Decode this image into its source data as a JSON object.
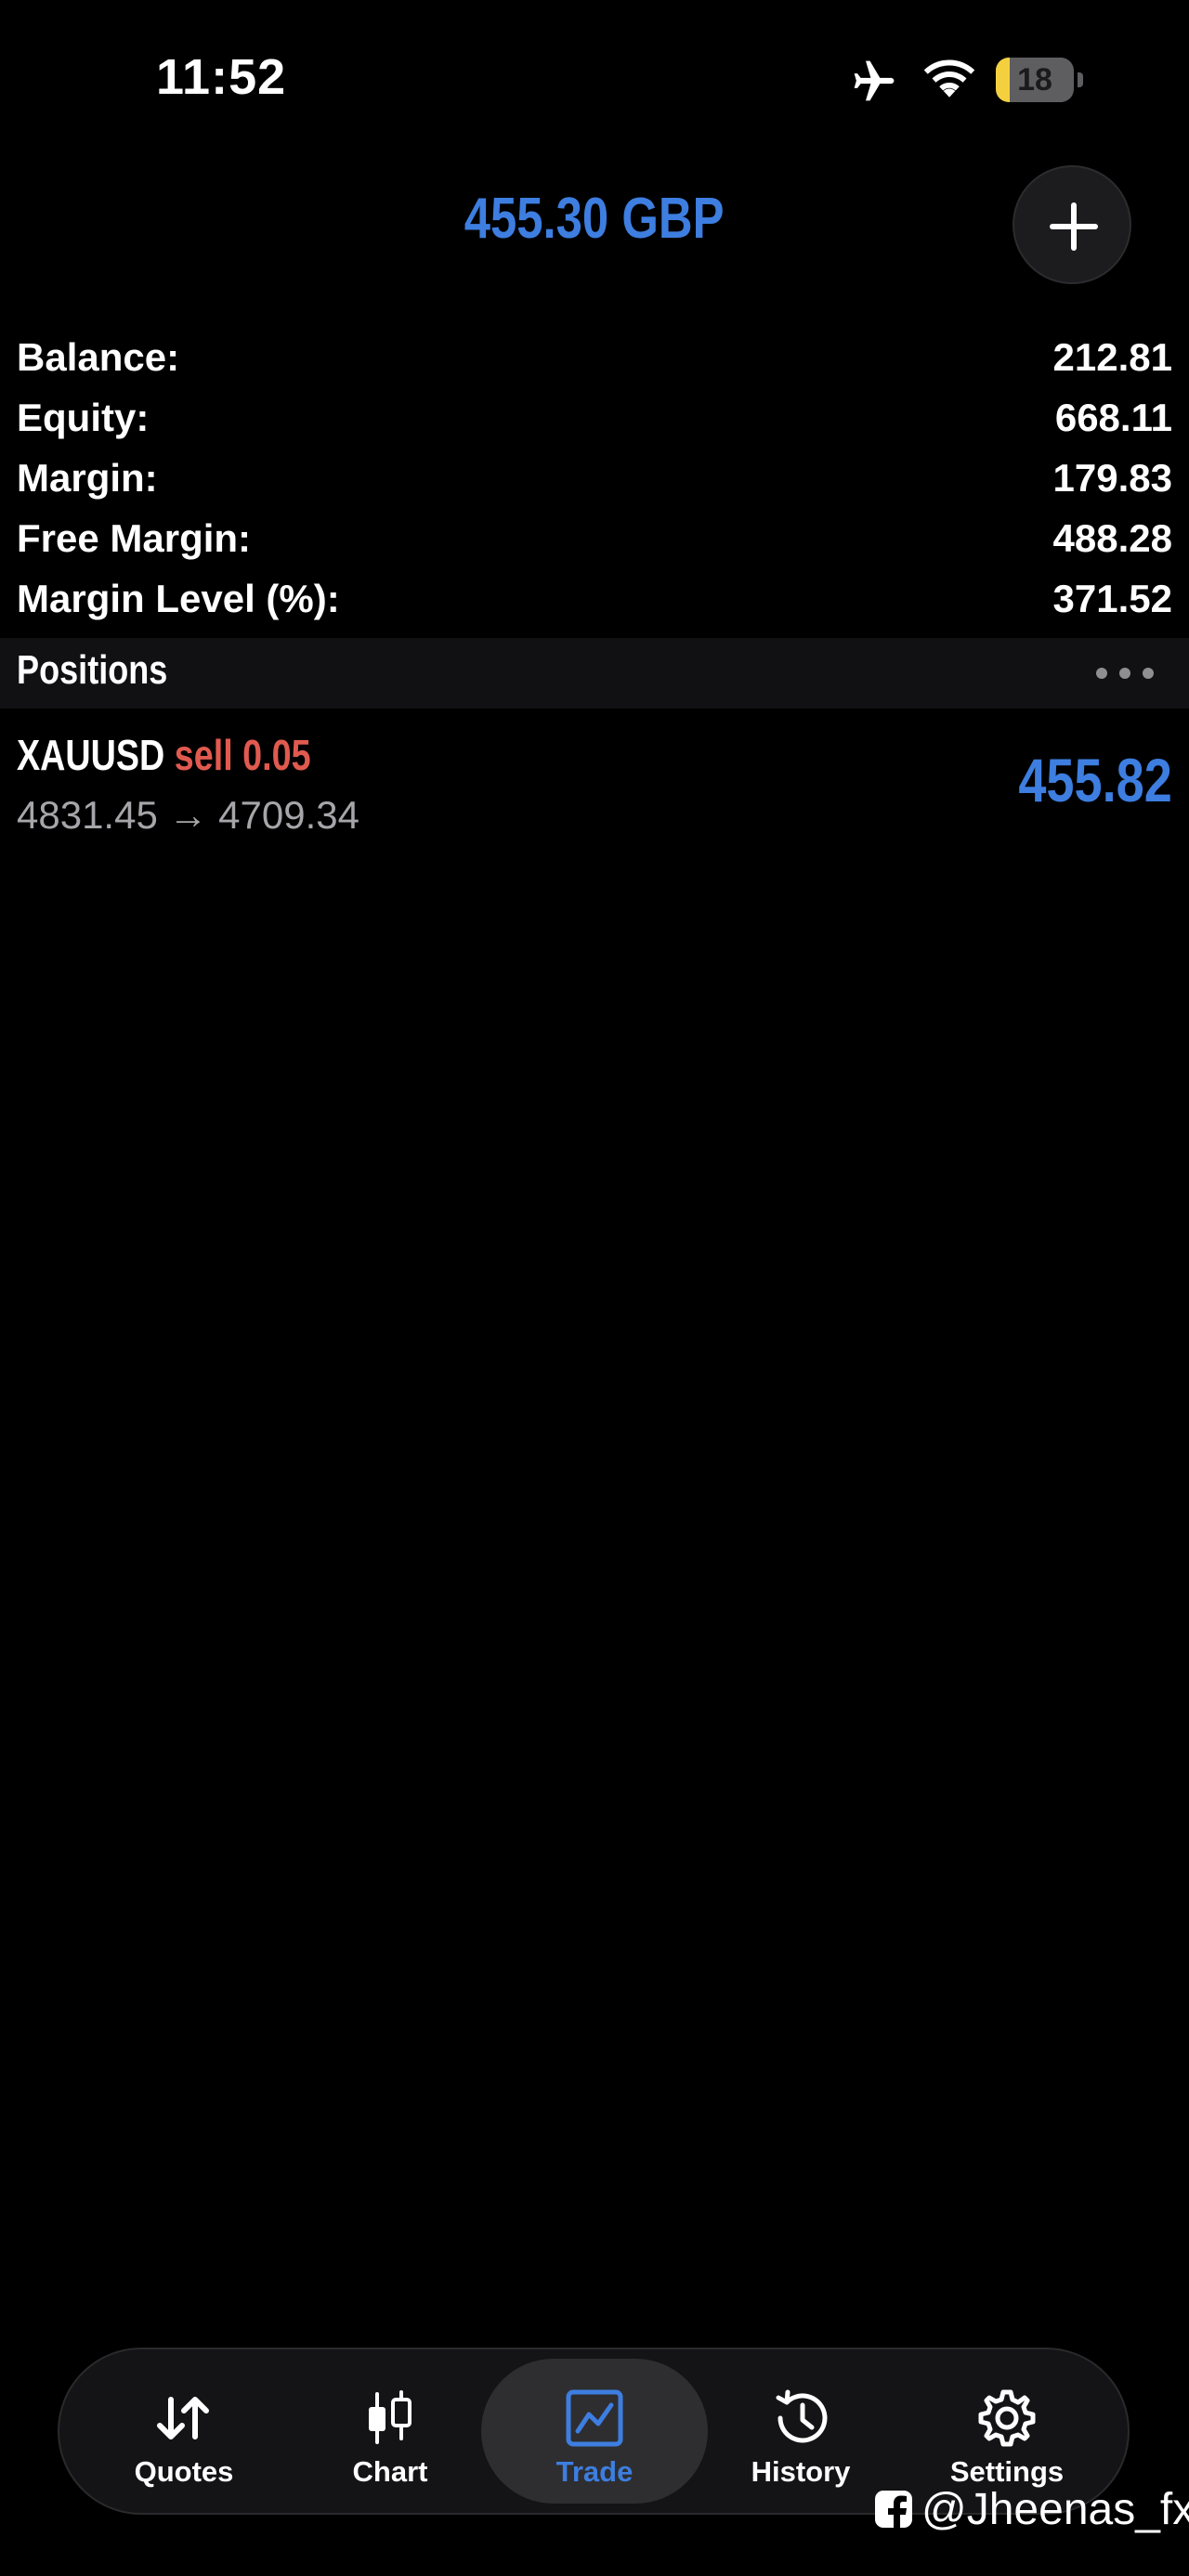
{
  "status_bar": {
    "time": "11:52",
    "battery_level": "18",
    "battery_fraction": 0.18,
    "icons": [
      "airplane-icon",
      "wifi-icon",
      "battery-icon"
    ]
  },
  "header": {
    "equity_display": "455.30 GBP",
    "add_icon": "plus-icon"
  },
  "summary": [
    {
      "label": "Balance:",
      "value": "212.81"
    },
    {
      "label": "Equity:",
      "value": "668.11"
    },
    {
      "label": "Margin:",
      "value": "179.83"
    },
    {
      "label": "Free Margin:",
      "value": "488.28"
    },
    {
      "label": "Margin Level (%):",
      "value": "371.52"
    }
  ],
  "positions": {
    "title": "Positions",
    "more_icon": "more-dots-icon",
    "items": [
      {
        "symbol": "XAUUSD",
        "side_volume": "sell 0.05",
        "prices": "4831.45 → 4709.34",
        "profit": "455.82"
      }
    ]
  },
  "tab_bar": {
    "tabs": [
      {
        "label": "Quotes",
        "icon": "arrows-updown-icon",
        "active": false
      },
      {
        "label": "Chart",
        "icon": "candlestick-icon",
        "active": false
      },
      {
        "label": "Trade",
        "icon": "trade-chart-icon",
        "active": true
      },
      {
        "label": "History",
        "icon": "history-clock-icon",
        "active": false
      },
      {
        "label": "Settings",
        "icon": "gear-icon",
        "active": false
      }
    ]
  },
  "watermark": {
    "handle": "@Jheenas_fx",
    "icon": "facebook-icon"
  },
  "colors": {
    "background": "#000000",
    "accent_blue": "#3d7ee0",
    "sell_red": "#e05a4f",
    "secondary_text": "#a6a6aa",
    "tab_inactive": "#ffffff"
  }
}
